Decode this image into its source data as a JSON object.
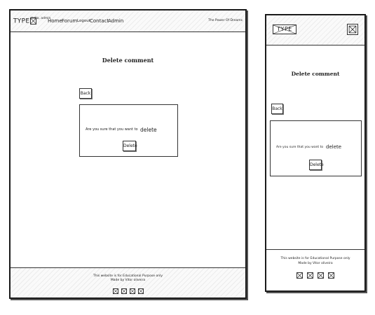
{
  "desktop": {
    "logo": "TYPE",
    "greeting": "Hello, admin",
    "nav": {
      "home": "Home",
      "forum": "Forum",
      "logout": "Logout",
      "contact": "Contact",
      "admin": "Admin"
    },
    "tagline": "The Power Of Dreams",
    "page_title": "Delete comment",
    "back_label": "Back",
    "confirm_text": "Are you sure that you want to",
    "confirm_word": "delete",
    "delete_label": "Delete",
    "footer_line1": "This website is for Educational Purpose only",
    "footer_line2": "Made by Vitor oliveira",
    "social_icons": [
      "social-icon-1",
      "social-icon-2",
      "social-icon-3",
      "social-icon-4"
    ]
  },
  "mobile": {
    "logo": "TYPE",
    "page_title": "Delete comment",
    "back_label": "Back",
    "confirm_text": "Are you sure that you want to",
    "confirm_word": "delete",
    "delete_label": "Delete",
    "footer_line1": "This website is for Educational Purpose only",
    "footer_line2": "Made by Vitor oliveira",
    "social_icons": [
      "social-icon-1",
      "social-icon-2",
      "social-icon-3",
      "social-icon-4"
    ]
  }
}
